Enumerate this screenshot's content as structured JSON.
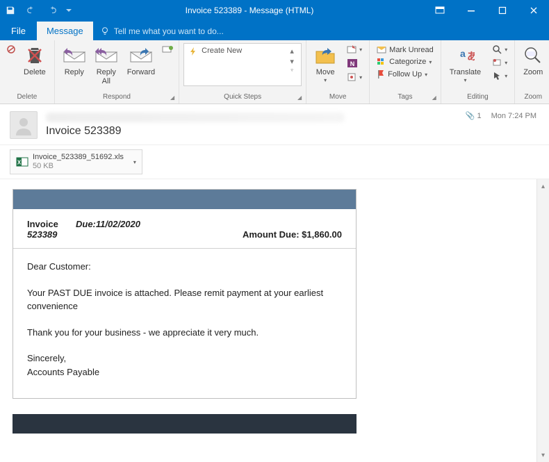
{
  "window_title": "Invoice 523389 - Message (HTML)",
  "tabs": {
    "file": "File",
    "message": "Message",
    "tellme": "Tell me what you want to do..."
  },
  "ribbon": {
    "delete": {
      "label": "Delete",
      "btn": "Delete"
    },
    "respond": {
      "label": "Respond",
      "reply": "Reply",
      "reply_all": "Reply\nAll",
      "forward": "Forward"
    },
    "quicksteps": {
      "label": "Quick Steps",
      "create": "Create New"
    },
    "move": {
      "label": "Move",
      "move": "Move"
    },
    "tags": {
      "label": "Tags",
      "unread": "Mark Unread",
      "categorize": "Categorize",
      "followup": "Follow Up"
    },
    "editing": {
      "label": "Editing",
      "translate": "Translate"
    },
    "zoom": {
      "label": "Zoom",
      "zoom": "Zoom"
    }
  },
  "message": {
    "subject": "Invoice 523389",
    "attach_count": "1",
    "timestamp": "Mon 7:24 PM",
    "attachment": {
      "name": "Invoice_523389_51692.xls",
      "size": "50 KB"
    }
  },
  "invoice": {
    "label": "Invoice",
    "number": "523389",
    "due_label_value": "Due:11/02/2020",
    "amount_label_value": "Amount Due: $1,860.00",
    "greeting": "Dear Customer:",
    "line1": "Your PAST DUE invoice is attached. Please remit payment at your earliest convenience",
    "line2": "Thank you for your business - we appreciate it very much.",
    "signoff1": "Sincerely,",
    "signoff2": "Accounts Payable"
  }
}
